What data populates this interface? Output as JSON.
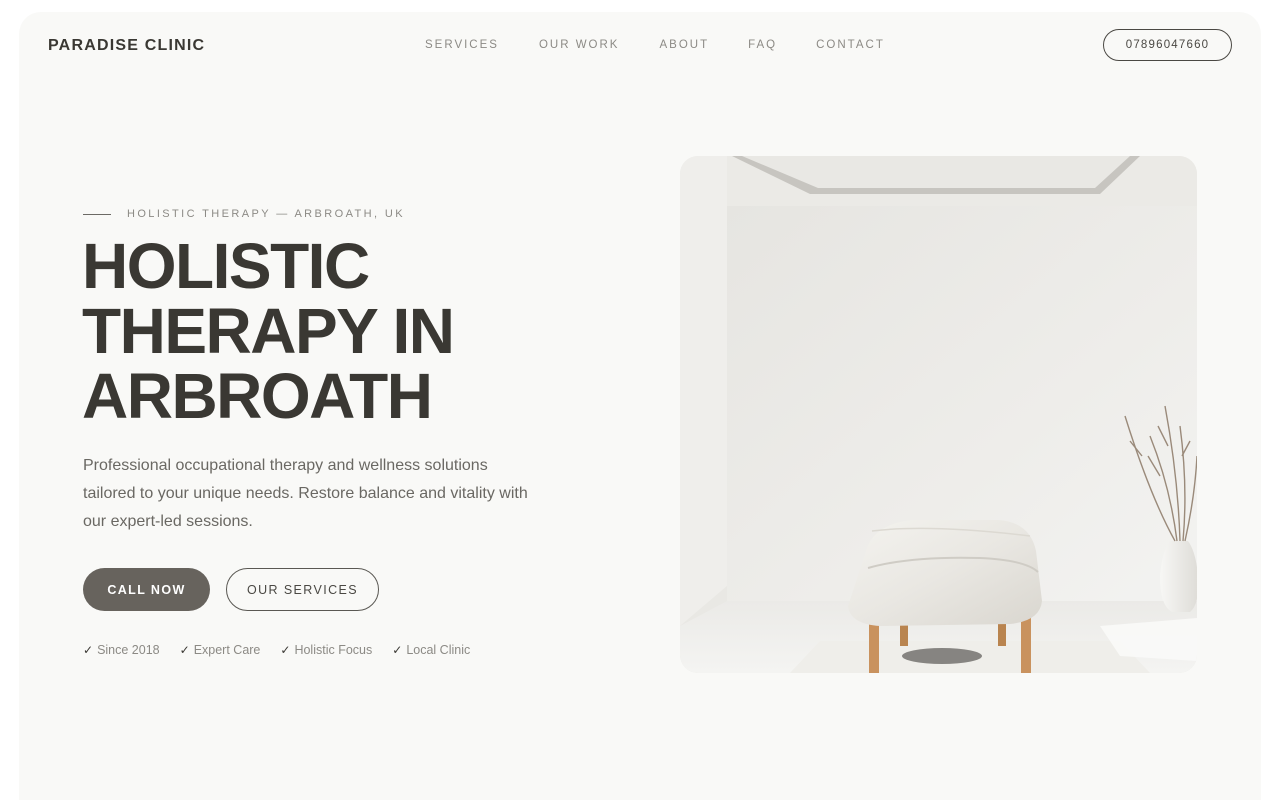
{
  "nav": {
    "brand": "PARADISE CLINIC",
    "links": [
      "SERVICES",
      "OUR WORK",
      "ABOUT",
      "FAQ",
      "CONTACT"
    ],
    "phone": "07896047660"
  },
  "hero": {
    "eyebrow": "HOLISTIC THERAPY — ARBROATH, UK",
    "headline_lines": [
      "HOLISTIC",
      "THERAPY IN",
      "ARBROATH"
    ],
    "lead": "Professional occupational therapy and wellness solutions tailored to your unique needs. Restore balance and vitality with our expert-led sessions.",
    "primary_cta": "CALL NOW",
    "secondary_cta": "OUR SERVICES",
    "badges": [
      "Since 2018",
      "Expert Care",
      "Holistic Focus",
      "Local Clinic"
    ],
    "badge_check": "✓"
  },
  "image": {
    "subject": "therapy-room-photo"
  },
  "colors": {
    "page_bg": "#f9f9f7",
    "text_dark": "#3a3833",
    "text_muted": "#8c8a85",
    "primary_button": "#67635d"
  }
}
